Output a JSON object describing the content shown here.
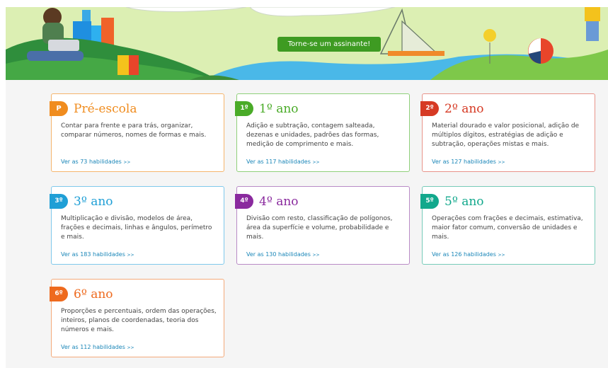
{
  "banner": {
    "cta_label": "Torne-se um assinante!"
  },
  "grades": [
    {
      "badge": "P",
      "title": "Pré-escola",
      "description": "Contar para frente e para trás, organizar, comparar números, nomes de formas e mais.",
      "link": "Ver as 73 habilidades",
      "link_suffix": ">>",
      "color": "#f08c1e"
    },
    {
      "badge": "1º",
      "title": "1º ano",
      "description": "Adição e subtração, contagem salteada, dezenas e unidades, padrões das formas, medição de comprimento e mais.",
      "link": "Ver as 117 habilidades",
      "link_suffix": ">>",
      "color": "#4aab28"
    },
    {
      "badge": "2º",
      "title": "2º ano",
      "description": "Material dourado e valor posicional, adição de múltiplos dígitos, estratégias de adição e subtração, operações mistas e mais.",
      "link": "Ver as 127 habilidades",
      "link_suffix": ">>",
      "color": "#d63a24"
    },
    {
      "badge": "3º",
      "title": "3º ano",
      "description": "Multiplicação e divisão, modelos de área, frações e decimais, linhas e ângulos, perímetro e mais.",
      "link": "Ver as 183 habilidades",
      "link_suffix": ">>",
      "color": "#1f9fd6"
    },
    {
      "badge": "4º",
      "title": "4º ano",
      "description": "Divisão com resto, classificação de polígonos, área da superfície e volume, probabilidade e mais.",
      "link": "Ver as 130 habilidades",
      "link_suffix": ">>",
      "color": "#8a2a9e"
    },
    {
      "badge": "5º",
      "title": "5º ano",
      "description": "Operações com frações e decimais, estimativa, maior fator comum, conversão de unidades e mais.",
      "link": "Ver as 126 habilidades",
      "link_suffix": ">>",
      "color": "#12a88c"
    },
    {
      "badge": "6º",
      "title": "6º ano",
      "description": "Proporções e percentuais, ordem das operações, inteiros, planos de coordenadas, teoria dos números e mais.",
      "link": "Ver as 112 habilidades",
      "link_suffix": ">>",
      "color": "#ee6a1e"
    }
  ]
}
